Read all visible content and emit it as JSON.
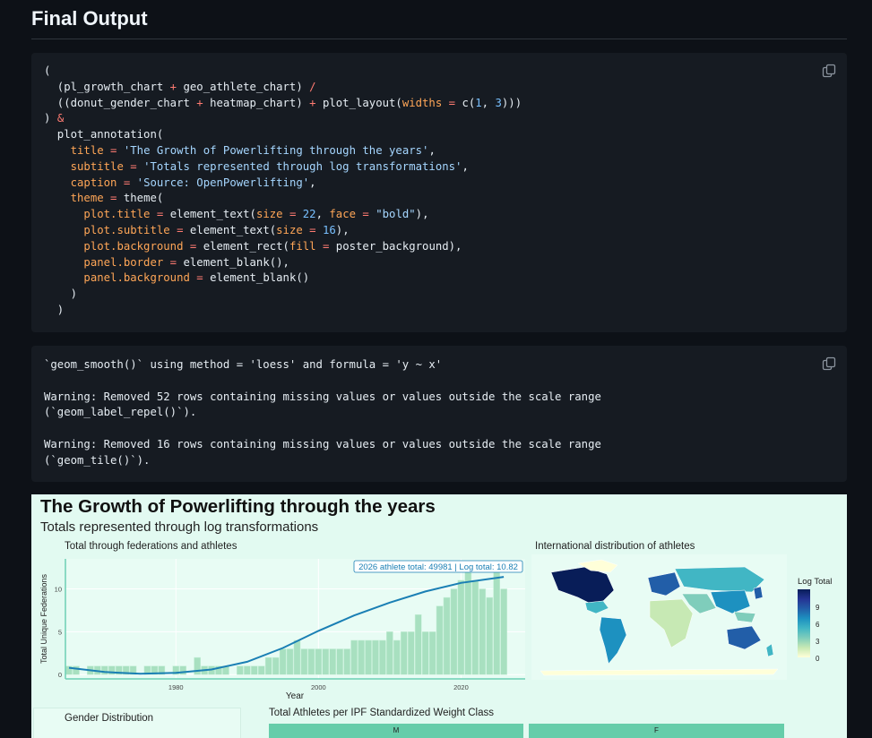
{
  "page": {
    "heading": "Final Output"
  },
  "code_cell": {
    "lines": [
      [
        {
          "t": "("
        }
      ],
      [
        {
          "t": "  (pl_growth_chart "
        },
        {
          "t": "+",
          "c": "op"
        },
        {
          "t": " geo_athlete_chart) "
        },
        {
          "t": "/",
          "c": "op"
        }
      ],
      [
        {
          "t": "  ((donut_gender_chart "
        },
        {
          "t": "+",
          "c": "op"
        },
        {
          "t": " heatmap_chart) "
        },
        {
          "t": "+",
          "c": "op"
        },
        {
          "t": " plot_layout("
        },
        {
          "t": "widths",
          "c": "arg"
        },
        {
          "t": " = ",
          "c": "op"
        },
        {
          "t": "c("
        },
        {
          "t": "1",
          "c": "num"
        },
        {
          "t": ", "
        },
        {
          "t": "3",
          "c": "num"
        },
        {
          "t": ")))"
        }
      ],
      [
        {
          "t": ") "
        },
        {
          "t": "&",
          "c": "op"
        }
      ],
      [
        {
          "t": "  plot_annotation("
        }
      ],
      [
        {
          "t": "    "
        },
        {
          "t": "title",
          "c": "arg"
        },
        {
          "t": " = ",
          "c": "op"
        },
        {
          "t": "'The Growth of Powerlifting through the years'",
          "c": "str"
        },
        {
          "t": ","
        }
      ],
      [
        {
          "t": "    "
        },
        {
          "t": "subtitle",
          "c": "arg"
        },
        {
          "t": " = ",
          "c": "op"
        },
        {
          "t": "'Totals represented through log transformations'",
          "c": "str"
        },
        {
          "t": ","
        }
      ],
      [
        {
          "t": "    "
        },
        {
          "t": "caption",
          "c": "arg"
        },
        {
          "t": " = ",
          "c": "op"
        },
        {
          "t": "'Source: OpenPowerlifting'",
          "c": "str"
        },
        {
          "t": ","
        }
      ],
      [
        {
          "t": "    "
        },
        {
          "t": "theme",
          "c": "arg"
        },
        {
          "t": " = ",
          "c": "op"
        },
        {
          "t": "theme("
        }
      ],
      [
        {
          "t": "      "
        },
        {
          "t": "plot.title",
          "c": "arg"
        },
        {
          "t": " = ",
          "c": "op"
        },
        {
          "t": "element_text("
        },
        {
          "t": "size",
          "c": "arg"
        },
        {
          "t": " = ",
          "c": "op"
        },
        {
          "t": "22",
          "c": "num"
        },
        {
          "t": ", "
        },
        {
          "t": "face",
          "c": "arg"
        },
        {
          "t": " = ",
          "c": "op"
        },
        {
          "t": "\"bold\"",
          "c": "str"
        },
        {
          "t": "),"
        }
      ],
      [
        {
          "t": "      "
        },
        {
          "t": "plot.subtitle",
          "c": "arg"
        },
        {
          "t": " = ",
          "c": "op"
        },
        {
          "t": "element_text("
        },
        {
          "t": "size",
          "c": "arg"
        },
        {
          "t": " = ",
          "c": "op"
        },
        {
          "t": "16",
          "c": "num"
        },
        {
          "t": "),"
        }
      ],
      [
        {
          "t": "      "
        },
        {
          "t": "plot.background",
          "c": "arg"
        },
        {
          "t": " = ",
          "c": "op"
        },
        {
          "t": "element_rect("
        },
        {
          "t": "fill",
          "c": "arg"
        },
        {
          "t": " = ",
          "c": "op"
        },
        {
          "t": "poster_background),"
        }
      ],
      [
        {
          "t": "      "
        },
        {
          "t": "panel.border",
          "c": "arg"
        },
        {
          "t": " = ",
          "c": "op"
        },
        {
          "t": "element_blank(),"
        }
      ],
      [
        {
          "t": "      "
        },
        {
          "t": "panel.background",
          "c": "arg"
        },
        {
          "t": " = ",
          "c": "op"
        },
        {
          "t": "element_blank()"
        }
      ],
      [
        {
          "t": "    )"
        }
      ],
      [
        {
          "t": "  )"
        }
      ]
    ]
  },
  "output_cell": {
    "lines": [
      "`geom_smooth()` using method = 'loess' and formula = 'y ~ x'",
      "",
      "Warning: Removed 52 rows containing missing values or values outside the scale range",
      "(`geom_label_repel()`).",
      "",
      "Warning: Removed 16 rows containing missing values or values outside the scale range",
      "(`geom_tile()`)."
    ]
  },
  "poster": {
    "title": "The Growth of Powerlifting through the years",
    "subtitle": "Totals represented through log transformations",
    "growth_panel_title": "Total through federations and athletes",
    "map_panel_title": "International distribution of athletes",
    "gender_panel_title": "Gender Distribution",
    "heatmap_panel_title": "Total Athletes per IPF Standardized Weight Class",
    "heatmap_facets": [
      "M",
      "F"
    ],
    "legend_title": "Log Total",
    "legend_ticks": [
      "9",
      "6",
      "3",
      "0"
    ],
    "legend_colors": [
      "#081d58",
      "#253494",
      "#225ea8",
      "#1d91c0",
      "#41b6c4",
      "#7fcdbb",
      "#c7e9b4",
      "#ffffd9"
    ]
  },
  "chart_data": {
    "type": "bar",
    "title": "Total through federations and athletes",
    "xlabel": "Year",
    "ylabel": "Total Unique Federations",
    "xlim": [
      1964.5,
      2029
    ],
    "ylim": [
      -0.5,
      13.5
    ],
    "x_ticks": [
      1980,
      2000,
      2020
    ],
    "y_ticks": [
      0,
      5,
      10
    ],
    "annotation": "2026 athlete total: 49981 | Log total: 10.82",
    "x": [
      1965,
      1966,
      1968,
      1969,
      1970,
      1971,
      1972,
      1973,
      1974,
      1976,
      1977,
      1978,
      1980,
      1981,
      1983,
      1984,
      1985,
      1986,
      1987,
      1989,
      1990,
      1991,
      1992,
      1993,
      1994,
      1995,
      1996,
      1997,
      1998,
      1999,
      2000,
      2001,
      2002,
      2003,
      2004,
      2005,
      2006,
      2007,
      2008,
      2009,
      2010,
      2011,
      2012,
      2013,
      2014,
      2015,
      2016,
      2017,
      2018,
      2019,
      2020,
      2021,
      2022,
      2023,
      2024,
      2025,
      2026
    ],
    "values": [
      1,
      1,
      1,
      1,
      1,
      1,
      1,
      1,
      1,
      1,
      1,
      1,
      1,
      1,
      2,
      1,
      1,
      1,
      1,
      1,
      1,
      1,
      1,
      2,
      2,
      3,
      3,
      4,
      3,
      3,
      3,
      3,
      3,
      3,
      3,
      4,
      4,
      4,
      4,
      4,
      5,
      4,
      5,
      5,
      7,
      5,
      5,
      8,
      9,
      10,
      11,
      12,
      11,
      10,
      9,
      12,
      10
    ],
    "series": [
      {
        "type": "smooth",
        "x": [
          1965,
          1970,
          1975,
          1980,
          1985,
          1990,
          1995,
          2000,
          2005,
          2010,
          2015,
          2020,
          2026
        ],
        "values": [
          0.8,
          0.3,
          0.1,
          0.2,
          0.6,
          1.5,
          3.1,
          5.1,
          6.9,
          8.4,
          9.7,
          10.7,
          11.4
        ]
      }
    ]
  }
}
